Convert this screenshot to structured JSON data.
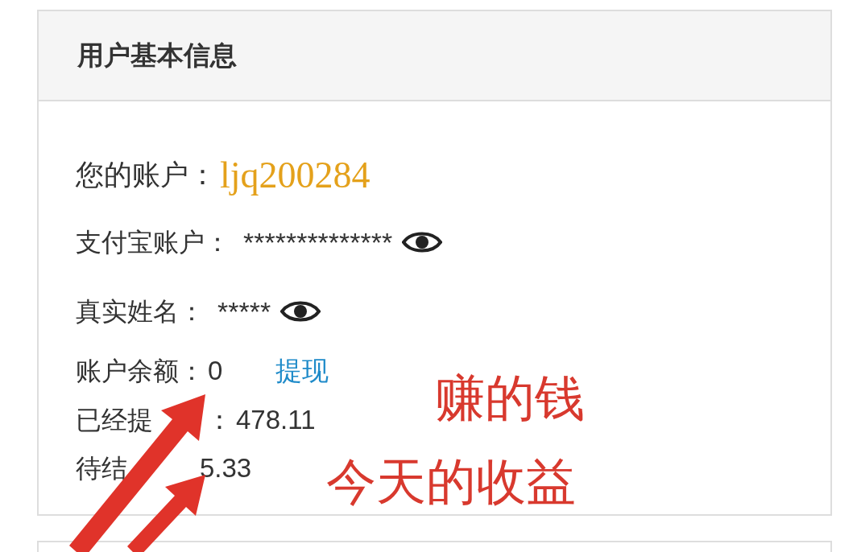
{
  "card": {
    "title": "用户基本信息",
    "rows": [
      {
        "kind": "account",
        "label": "您的账户：",
        "value": "ljq200284"
      },
      {
        "kind": "masked",
        "label": "支付宝账户：",
        "value": "**************"
      },
      {
        "kind": "masked",
        "label": "真实姓名：",
        "value": "*****"
      },
      {
        "kind": "balance",
        "label": "账户余额：",
        "value": "0",
        "link": "提现"
      },
      {
        "kind": "plain",
        "label": "已经提",
        "sep": "：",
        "value": "478.11"
      },
      {
        "kind": "plain",
        "label": "待结",
        "value": "5.33"
      }
    ]
  },
  "annotations": [
    "赚的钱",
    "今天的收益"
  ]
}
